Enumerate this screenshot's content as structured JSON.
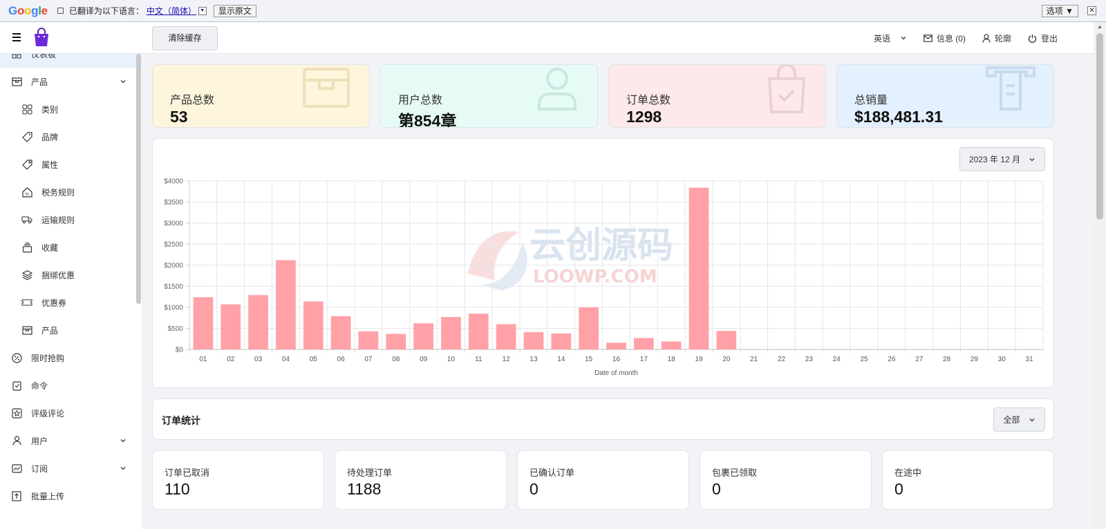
{
  "translate_bar": {
    "logo": [
      "G",
      "o",
      "o",
      "g",
      "l",
      "e"
    ],
    "translated_text": "已翻译为以下语言：",
    "language": "中文（简体）",
    "show_original": "显示原文",
    "options": "选项 ▼",
    "close": "✕"
  },
  "header": {
    "clear_cache": "清除缓存",
    "language": "英语",
    "messages": "信息 (0)",
    "profile": "轮廓",
    "logout": "登出"
  },
  "sidebar": {
    "items": [
      {
        "label": "仪表板",
        "icon": "dashboard-icon",
        "level": "top",
        "active": true
      },
      {
        "label": "产品",
        "icon": "box-icon",
        "level": "top",
        "expanded": true
      },
      {
        "label": "类别",
        "icon": "grid-icon",
        "level": "sub"
      },
      {
        "label": "品牌",
        "icon": "tag-icon",
        "level": "sub"
      },
      {
        "label": "属性",
        "icon": "tag-outline-icon",
        "level": "sub"
      },
      {
        "label": "税务规则",
        "icon": "tax-icon",
        "level": "sub"
      },
      {
        "label": "运输规则",
        "icon": "truck-icon",
        "level": "sub"
      },
      {
        "label": "收藏",
        "icon": "collection-icon",
        "level": "sub"
      },
      {
        "label": "捆绑优惠",
        "icon": "layers-icon",
        "level": "sub"
      },
      {
        "label": "优惠券",
        "icon": "ticket-icon",
        "level": "sub"
      },
      {
        "label": "产品",
        "icon": "box-icon",
        "level": "sub"
      },
      {
        "label": "限时抢购",
        "icon": "percent-icon",
        "level": "top"
      },
      {
        "label": "命令",
        "icon": "clipboard-icon",
        "level": "top"
      },
      {
        "label": "评级评论",
        "icon": "star-icon",
        "level": "top"
      },
      {
        "label": "用户",
        "icon": "user-icon",
        "level": "top",
        "has_children": true
      },
      {
        "label": "订阅",
        "icon": "subscribe-icon",
        "level": "top",
        "has_children": true
      },
      {
        "label": "批量上传",
        "icon": "upload-icon",
        "level": "top"
      }
    ]
  },
  "stats": [
    {
      "label": "产品总数",
      "value": "53",
      "bg": "#fdf5dc",
      "icon": "box-icon"
    },
    {
      "label": "用户总数",
      "value": "第854章",
      "bg": "#e6fbf6",
      "icon": "user-icon"
    },
    {
      "label": "订单总数",
      "value": "1298",
      "bg": "#fde9ea",
      "icon": "bag-icon"
    },
    {
      "label": "总销量",
      "value": "$188,481.31",
      "bg": "#e3f0fd",
      "icon": "sales-icon"
    }
  ],
  "chart_month": "2023 年 12 月",
  "watermark": {
    "line1": "云创源码",
    "line2": "LOOWP.COM"
  },
  "chart_data": {
    "type": "bar",
    "categories": [
      "01",
      "02",
      "03",
      "04",
      "05",
      "06",
      "07",
      "08",
      "09",
      "10",
      "11",
      "12",
      "13",
      "14",
      "15",
      "16",
      "17",
      "18",
      "19",
      "20",
      "21",
      "22",
      "23",
      "24",
      "25",
      "26",
      "27",
      "28",
      "29",
      "30",
      "31"
    ],
    "values": [
      1240,
      1070,
      1290,
      2120,
      1140,
      790,
      430,
      370,
      620,
      770,
      850,
      600,
      410,
      380,
      1000,
      160,
      270,
      190,
      3840,
      440,
      0,
      0,
      0,
      0,
      0,
      0,
      0,
      0,
      0,
      0,
      0
    ],
    "xlabel": "Date of month",
    "ylabel": "",
    "ylim": [
      0,
      4000
    ],
    "yticks": [
      0,
      500,
      1000,
      1500,
      2000,
      2500,
      3000,
      3500,
      4000
    ],
    "ytick_labels": [
      "$0",
      "$500",
      "$1000",
      "$1500",
      "$2000",
      "$2500",
      "$3000",
      "$3500",
      "$4000"
    ],
    "bar_color": "#ffa1a7",
    "grid": true
  },
  "orders": {
    "title": "订单统计",
    "filter": "全部",
    "stats": [
      {
        "label": "订单已取消",
        "value": "110"
      },
      {
        "label": "待处理订单",
        "value": "1188"
      },
      {
        "label": "已确认订单",
        "value": "0"
      },
      {
        "label": "包裹已领取",
        "value": "0"
      },
      {
        "label": "在途中",
        "value": "0"
      }
    ]
  }
}
